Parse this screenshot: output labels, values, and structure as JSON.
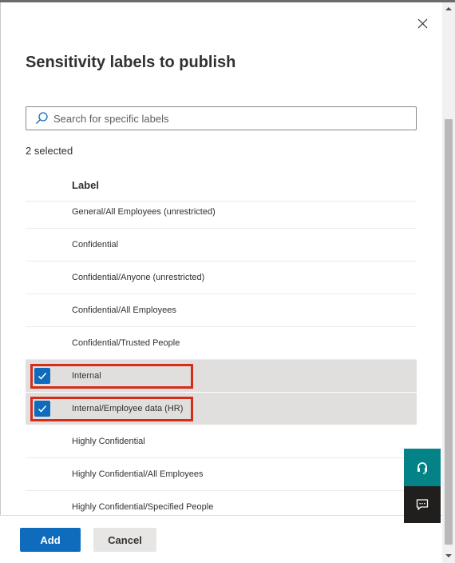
{
  "panel": {
    "title": "Sensitivity labels to publish",
    "selected_count": "2 selected"
  },
  "search": {
    "placeholder": "Search for specific labels",
    "value": ""
  },
  "list": {
    "column_header": "Label",
    "rows": [
      {
        "label": "General/All Employees (unrestricted)",
        "checked": false
      },
      {
        "label": "Confidential",
        "checked": false
      },
      {
        "label": "Confidential/Anyone (unrestricted)",
        "checked": false
      },
      {
        "label": "Confidential/All Employees",
        "checked": false
      },
      {
        "label": "Confidential/Trusted People",
        "checked": false
      },
      {
        "label": "Internal",
        "checked": true,
        "highlighted": true
      },
      {
        "label": "Internal/Employee data (HR)",
        "checked": true,
        "highlighted": true
      },
      {
        "label": "Highly Confidential",
        "checked": false
      },
      {
        "label": "Highly Confidential/All Employees",
        "checked": false
      },
      {
        "label": "Highly Confidential/Specified People",
        "checked": false
      }
    ]
  },
  "footer": {
    "add_label": "Add",
    "cancel_label": "Cancel"
  },
  "icons": {
    "close": "close-icon",
    "search": "search-icon",
    "check": "checkmark-icon",
    "help": "headset-icon",
    "feedback": "feedback-icon"
  },
  "colors": {
    "accent": "#0f6cbd",
    "highlight_border": "#d62c1a",
    "selected_row": "#e1dfdd",
    "help_button": "#038387",
    "feedback_button": "#201f1e"
  }
}
